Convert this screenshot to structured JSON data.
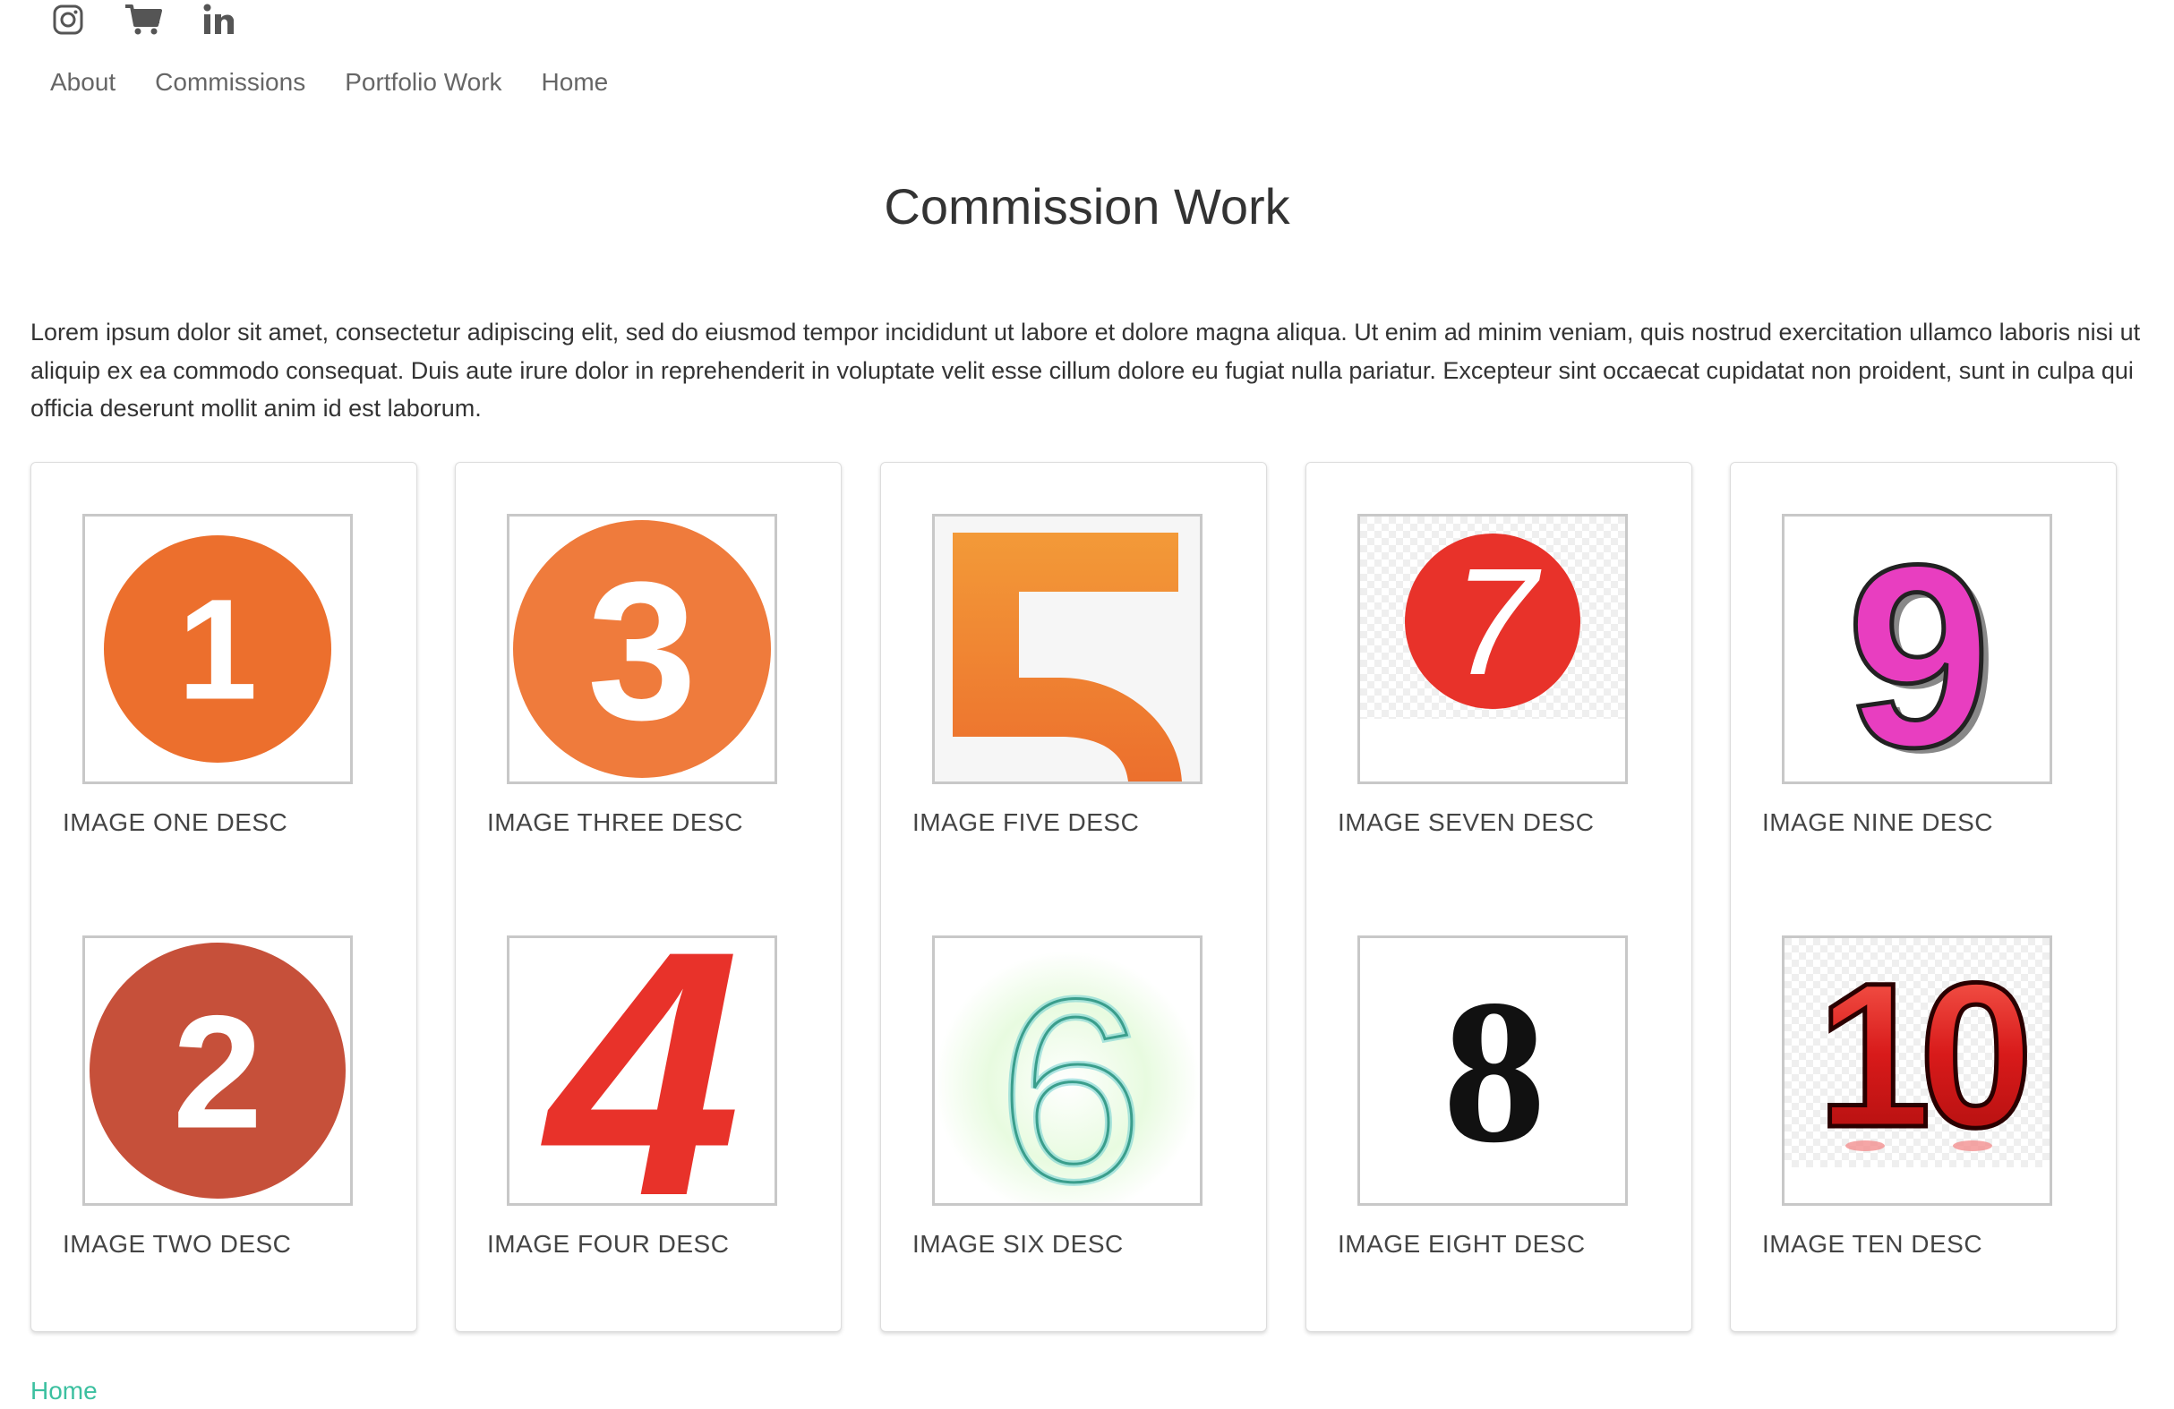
{
  "social": [
    {
      "icon": "instagram-icon"
    },
    {
      "icon": "shopping-cart-icon"
    },
    {
      "icon": "linkedin-icon"
    }
  ],
  "nav": {
    "items": [
      "About",
      "Commissions",
      "Portfolio Work",
      "Home"
    ]
  },
  "page": {
    "title": "Commission Work",
    "intro": "Lorem ipsum dolor sit amet, consectetur adipiscing elit, sed do eiusmod tempor incididunt ut labore et dolore magna aliqua. Ut enim ad minim veniam, quis nostrud exercitation ullamco laboris nisi ut aliquip ex ea commodo consequat. Duis aute irure dolor in reprehenderit in voluptate velit esse cillum dolore eu fugiat nulla pariatur. Excepteur sint occaecat cupidatat non proident, sunt in culpa qui officia deserunt mollit anim id est laborum."
  },
  "gallery": {
    "cards": [
      {
        "top": {
          "numeral": "1",
          "desc": "IMAGE ONE DESC"
        },
        "bottom": {
          "numeral": "2",
          "desc": "IMAGE TWO DESC"
        }
      },
      {
        "top": {
          "numeral": "3",
          "desc": "IMAGE THREE DESC"
        },
        "bottom": {
          "numeral": "4",
          "desc": "IMAGE FOUR DESC"
        }
      },
      {
        "top": {
          "numeral": "5",
          "desc": "IMAGE FIVE DESC"
        },
        "bottom": {
          "numeral": "6",
          "desc": "IMAGE SIX DESC"
        }
      },
      {
        "top": {
          "numeral": "7",
          "desc": "IMAGE SEVEN DESC"
        },
        "bottom": {
          "numeral": "8",
          "desc": "IMAGE EIGHT DESC"
        }
      },
      {
        "top": {
          "numeral": "9",
          "desc": "IMAGE NINE DESC"
        },
        "bottom": {
          "numeral": "10",
          "desc": "IMAGE TEN DESC"
        }
      }
    ]
  },
  "footer": {
    "home_link": "Home"
  },
  "colors": {
    "link": "#3cc0a0",
    "nav": "#666666",
    "text": "#333333",
    "orange": "#ec6f2d",
    "red": "#e8322a",
    "rust": "#c6503a",
    "magenta": "#e83ec0"
  }
}
